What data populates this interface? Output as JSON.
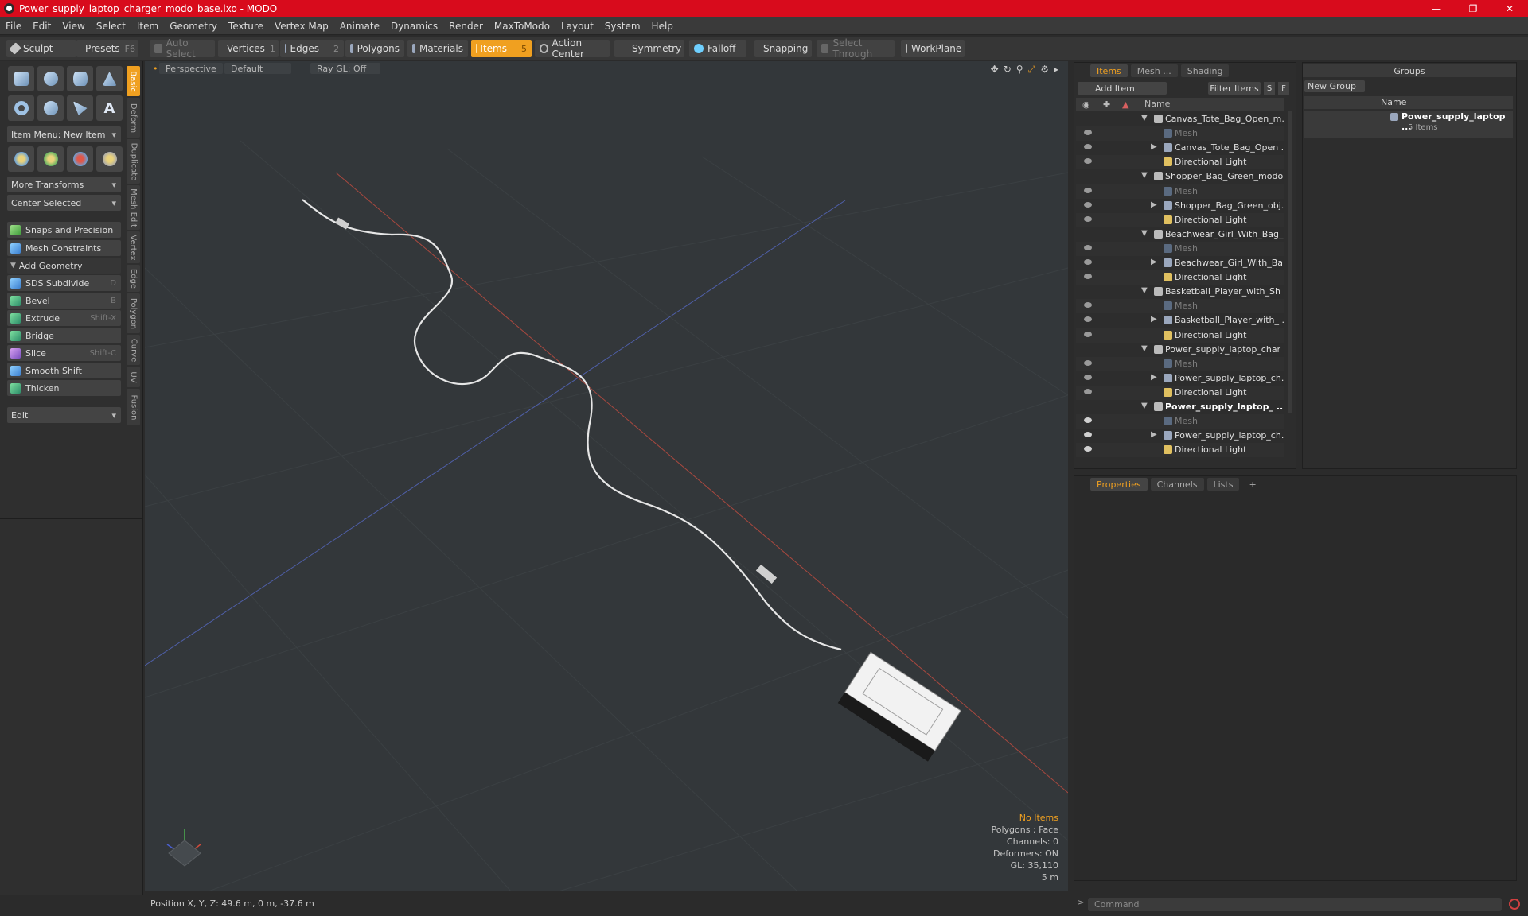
{
  "window": {
    "title": "Power_supply_laptop_charger_modo_base.lxo - MODO"
  },
  "menu": [
    "File",
    "Edit",
    "View",
    "Select",
    "Item",
    "Geometry",
    "Texture",
    "Vertex Map",
    "Animate",
    "Dynamics",
    "Render",
    "MaxToModo",
    "Layout",
    "System",
    "Help"
  ],
  "toolbar": {
    "sculpt": "Sculpt",
    "presets": "Presets",
    "presets_key": "F6",
    "auto_select": "Auto Select",
    "vertices": "Vertices",
    "vertices_count": "1",
    "edges": "Edges",
    "edges_count": "2",
    "polygons": "Polygons",
    "materials": "Materials",
    "items": "Items",
    "items_count": "5",
    "action_center": "Action Center",
    "symmetry": "Symmetry",
    "falloff": "Falloff",
    "snapping": "Snapping",
    "select_through": "Select Through",
    "workplane": "WorkPlane"
  },
  "left": {
    "item_menu": "Item Menu: New Item",
    "more_transforms": "More Transforms",
    "center_selected": "Center Selected",
    "snaps": "Snaps and Precision",
    "mesh_constraints": "Mesh Constraints",
    "add_geometry": "Add Geometry",
    "tools": [
      {
        "label": "SDS Subdivide",
        "key": "D"
      },
      {
        "label": "Bevel",
        "key": "B"
      },
      {
        "label": "Extrude",
        "key": "Shift-X"
      },
      {
        "label": "Bridge",
        "key": ""
      },
      {
        "label": "Slice",
        "key": "Shift-C"
      },
      {
        "label": "Smooth Shift",
        "key": ""
      },
      {
        "label": "Thicken",
        "key": ""
      }
    ],
    "edit": "Edit",
    "vtabs": [
      "Basic",
      "Deform",
      "Duplicate",
      "Mesh Edit",
      "Vertex",
      "Edge",
      "Polygon",
      "Curve",
      "UV",
      "Fusion"
    ]
  },
  "viewport": {
    "perspective": "Perspective",
    "shading": "Default",
    "raygl": "Ray GL: Off",
    "info": {
      "items": "No Items",
      "polygons": "Polygons : Face",
      "channels": "Channels: 0",
      "deformers": "Deformers: ON",
      "gl": "GL: 35,110",
      "scale": "5 m"
    }
  },
  "status": {
    "position": "Position X, Y, Z:  49.6 m, 0 m, -37.6 m"
  },
  "items_panel": {
    "tabs": [
      "Items",
      "Mesh ...",
      "Shading"
    ],
    "add_item": "Add Item",
    "filter_items": "Filter Items",
    "s": "S",
    "f": "F",
    "col_name": "Name",
    "rows": [
      {
        "text": "Canvas_Tote_Bag_Open_m...",
        "kind": "scene"
      },
      {
        "text": "Mesh",
        "kind": "mesh"
      },
      {
        "text": "Canvas_Tote_Bag_Open ...",
        "kind": "obj"
      },
      {
        "text": "Directional Light",
        "kind": "light"
      },
      {
        "text": "Shopper_Bag_Green_modo ...",
        "kind": "scene"
      },
      {
        "text": "Mesh",
        "kind": "mesh"
      },
      {
        "text": "Shopper_Bag_Green_obj...",
        "kind": "obj"
      },
      {
        "text": "Directional Light",
        "kind": "light"
      },
      {
        "text": "Beachwear_Girl_With_Bag_...",
        "kind": "scene"
      },
      {
        "text": "Mesh",
        "kind": "mesh"
      },
      {
        "text": "Beachwear_Girl_With_Ba...",
        "kind": "obj"
      },
      {
        "text": "Directional Light",
        "kind": "light"
      },
      {
        "text": "Basketball_Player_with_Sh ...",
        "kind": "scene"
      },
      {
        "text": "Mesh",
        "kind": "mesh"
      },
      {
        "text": "Basketball_Player_with_ ...",
        "kind": "obj"
      },
      {
        "text": "Directional Light",
        "kind": "light"
      },
      {
        "text": "Power_supply_laptop_char ...",
        "kind": "scene"
      },
      {
        "text": "Mesh",
        "kind": "mesh"
      },
      {
        "text": "Power_supply_laptop_ch...",
        "kind": "obj"
      },
      {
        "text": "Directional Light",
        "kind": "light"
      },
      {
        "text": "Power_supply_laptop_ ...",
        "kind": "scene-bold"
      },
      {
        "text": "Mesh",
        "kind": "mesh"
      },
      {
        "text": "Power_supply_laptop_ch...",
        "kind": "obj"
      },
      {
        "text": "Directional Light",
        "kind": "light"
      }
    ]
  },
  "groups_panel": {
    "title": "Groups",
    "new_group": "New Group",
    "col_name": "Name",
    "group_name": "Power_supply_laptop ...",
    "group_count": "5 Items"
  },
  "props_panel": {
    "tabs": [
      "Properties",
      "Channels",
      "Lists"
    ],
    "plus": "+"
  },
  "command": {
    "placeholder": "Command"
  },
  "colors": {
    "accent": "#f0a020",
    "titlebar": "#d80b1c"
  }
}
